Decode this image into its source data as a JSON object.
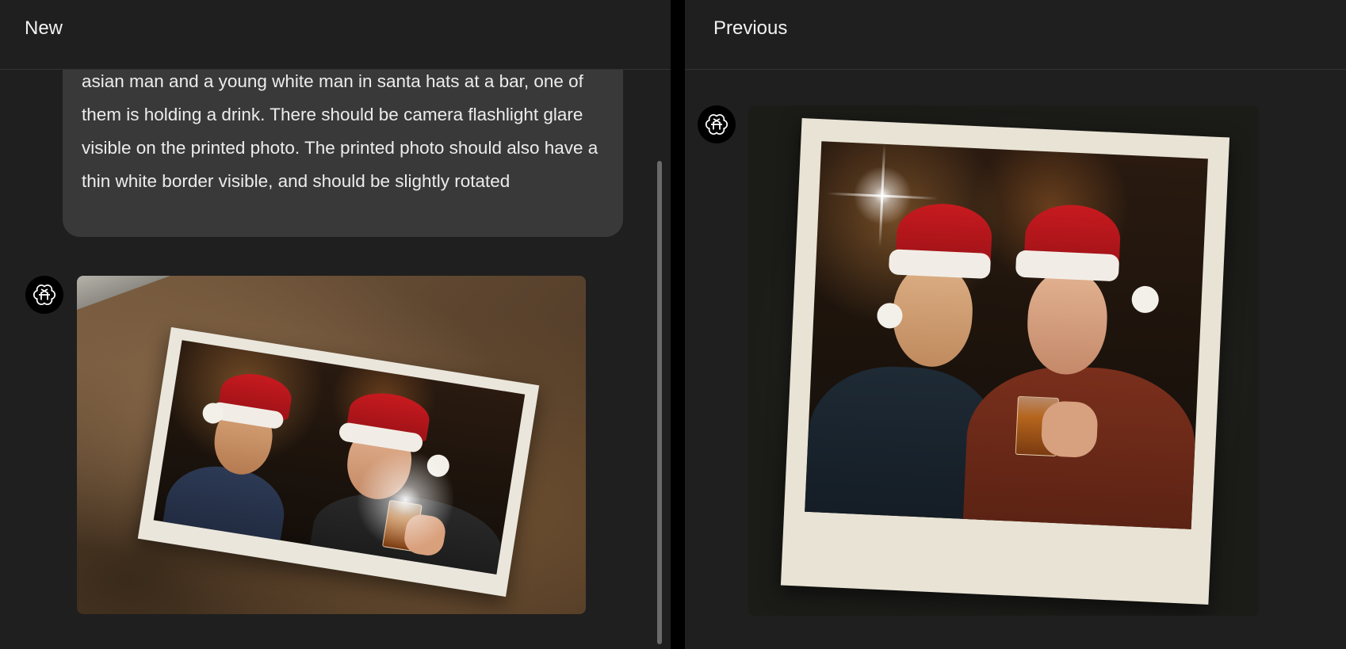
{
  "left_pane": {
    "title": "New",
    "user_message": "asian man and a young white man in santa hats at a bar, one of them is holding a drink. There should be camera flashlight glare visible on the printed photo. The printed photo should also have a thin white border visible, and should be slightly rotated",
    "assistant_image": "printed photo of two men in santa hats on a stone surface"
  },
  "right_pane": {
    "title": "Previous",
    "assistant_image": "polaroid-style photo of two men in santa hats at a bar"
  },
  "icons": {
    "assistant_avatar": "openai-logo-icon"
  },
  "colors": {
    "pane_bg": "#1f1f1f",
    "bubble_bg": "#393939",
    "divider": "#000000",
    "text": "#ececec"
  }
}
